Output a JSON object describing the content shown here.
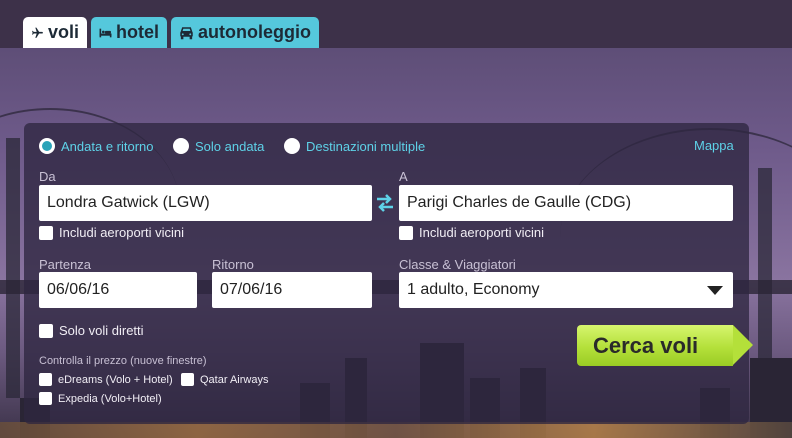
{
  "tabs": [
    {
      "label": "voli",
      "icon": "plane-icon"
    },
    {
      "label": "hotel",
      "icon": "bed-icon"
    },
    {
      "label": "autonoleggio",
      "icon": "car-icon"
    }
  ],
  "trip_type": {
    "options": [
      "Andata e ritorno",
      "Solo andata",
      "Destinazioni multiple"
    ],
    "selected": "Andata e ritorno"
  },
  "map_link": "Mappa",
  "from": {
    "label": "Da",
    "value": "Londra Gatwick (LGW)",
    "nearby": "Includi aeroporti vicini"
  },
  "to": {
    "label": "A",
    "value": "Parigi Charles de Gaulle (CDG)",
    "nearby": "Includi aeroporti vicini"
  },
  "departure": {
    "label": "Partenza",
    "value": "06/06/16"
  },
  "return": {
    "label": "Ritorno",
    "value": "07/06/16"
  },
  "class_travellers": {
    "label": "Classe & Viaggiatori",
    "value": "1 adulto, Economy"
  },
  "direct_only": "Solo voli diretti",
  "price_check": {
    "title": "Controlla il prezzo (nuove finestre)",
    "options": [
      "eDreams (Volo + Hotel)",
      "Qatar Airways",
      "Expedia (Volo+Hotel)"
    ]
  },
  "search_button": "Cerca voli",
  "colors": {
    "accent": "#5ed2e8",
    "tab_inactive": "#55c8dc",
    "button": "#b4e03a"
  }
}
